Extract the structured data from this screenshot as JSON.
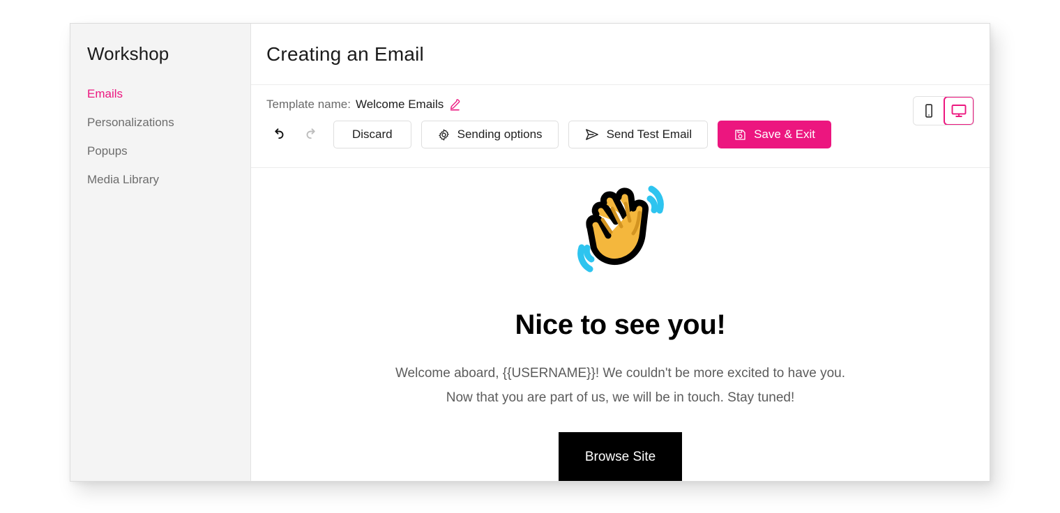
{
  "sidebar": {
    "title": "Workshop",
    "items": [
      {
        "label": "Emails",
        "active": true
      },
      {
        "label": "Personalizations",
        "active": false
      },
      {
        "label": "Popups",
        "active": false
      },
      {
        "label": "Media Library",
        "active": false
      }
    ]
  },
  "header": {
    "title": "Creating an Email"
  },
  "toolbar": {
    "template_label": "Template name:",
    "template_value": "Welcome Emails",
    "edit_icon": "pencil-edit-icon",
    "undo_icon": "undo-arrow-icon",
    "redo_icon": "redo-arrow-icon",
    "discard_label": "Discard",
    "sending_options_label": "Sending options",
    "sending_options_icon": "gear-icon",
    "send_test_label": "Send Test Email",
    "send_test_icon": "send-plane-icon",
    "save_exit_label": "Save & Exit",
    "save_exit_icon": "floppy-save-icon"
  },
  "device_toggle": {
    "mobile_icon": "mobile-phone-icon",
    "desktop_icon": "desktop-monitor-icon",
    "selected": "desktop"
  },
  "email": {
    "emoji": "waving-hand-emoji",
    "heading": "Nice to see you!",
    "paragraph_line_1": "Welcome aboard, {{USERNAME}}! We couldn't be more excited to have you.",
    "paragraph_line_2": "Now that you are part of us, we will be in touch. Stay tuned!",
    "cta_label": "Browse Site"
  },
  "colors": {
    "accent": "#EC167F",
    "sidebar_bg": "#F4F4F4",
    "cta_bg": "#000000",
    "text_dark": "#1C1C1C",
    "text_muted": "#6A6A6A"
  }
}
